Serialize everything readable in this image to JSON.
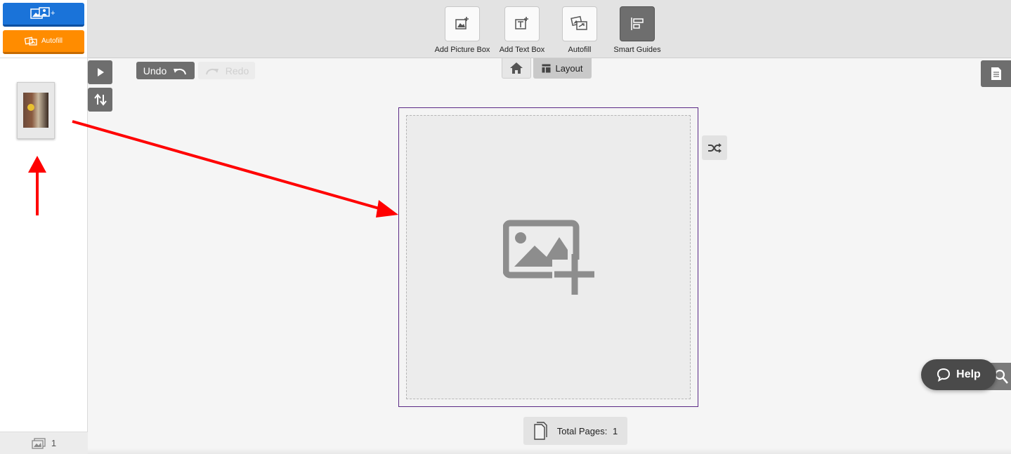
{
  "sidebar": {
    "autofill_label": "Autofill",
    "photo_count": "1"
  },
  "toolbar": {
    "tools": [
      {
        "label": "Add Picture Box",
        "icon": "add-picture-box-icon"
      },
      {
        "label": "Add Text Box",
        "icon": "add-text-box-icon"
      },
      {
        "label": "Autofill",
        "icon": "autofill-icon"
      },
      {
        "label": "Smart Guides",
        "icon": "smart-guides-icon",
        "active": true
      }
    ]
  },
  "editor": {
    "undo_label": "Undo",
    "redo_label": "Redo",
    "layout_label": "Layout",
    "total_pages_label": "Total Pages:",
    "total_pages_value": "1",
    "help_label": "Help"
  },
  "colors": {
    "primary_blue": "#1a73d9",
    "autofill_orange": "#ff8c00",
    "annotation_red": "#ff0000",
    "page_border": "#5b2a86"
  }
}
